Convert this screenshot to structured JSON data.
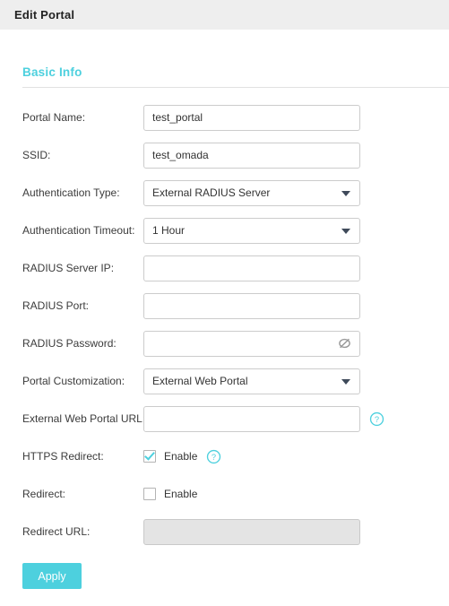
{
  "window": {
    "title": "Edit Portal"
  },
  "section": {
    "heading": "Basic Info"
  },
  "colors": {
    "accent": "#4dd0de",
    "titlebar_bg": "#eeeeee",
    "border": "#cccccc",
    "disabled_bg": "#e4e4e4",
    "caret": "#3f4a5a"
  },
  "fields": {
    "portal_name": {
      "label": "Portal Name:",
      "value": "test_portal",
      "placeholder": ""
    },
    "ssid": {
      "label": "SSID:",
      "value": "test_omada",
      "placeholder": ""
    },
    "auth_type": {
      "label": "Authentication Type:",
      "value": "External RADIUS Server",
      "options": [
        "External RADIUS Server"
      ]
    },
    "auth_timeout": {
      "label": "Authentication Timeout:",
      "value": "1 Hour",
      "options": [
        "1 Hour"
      ]
    },
    "radius_server_ip": {
      "label": "RADIUS Server IP:",
      "value": "",
      "placeholder": ""
    },
    "radius_port": {
      "label": "RADIUS Port:",
      "value": "",
      "placeholder": ""
    },
    "radius_password": {
      "label": "RADIUS Password:",
      "value": "",
      "placeholder": "",
      "icon": "eye-slash-icon"
    },
    "portal_customization": {
      "label": "Portal Customization:",
      "value": "External Web Portal",
      "options": [
        "External Web Portal"
      ]
    },
    "external_web_portal_url": {
      "label": "External Web Portal URL:",
      "value": "",
      "placeholder": "",
      "icon": "help-icon"
    },
    "https_redirect": {
      "label": "HTTPS Redirect:",
      "checkbox_label": "Enable",
      "checked": true,
      "icon": "help-icon"
    },
    "redirect": {
      "label": "Redirect:",
      "checkbox_label": "Enable",
      "checked": false
    },
    "redirect_url": {
      "label": "Redirect URL:",
      "value": "",
      "disabled": true
    }
  },
  "buttons": {
    "apply": "Apply"
  }
}
